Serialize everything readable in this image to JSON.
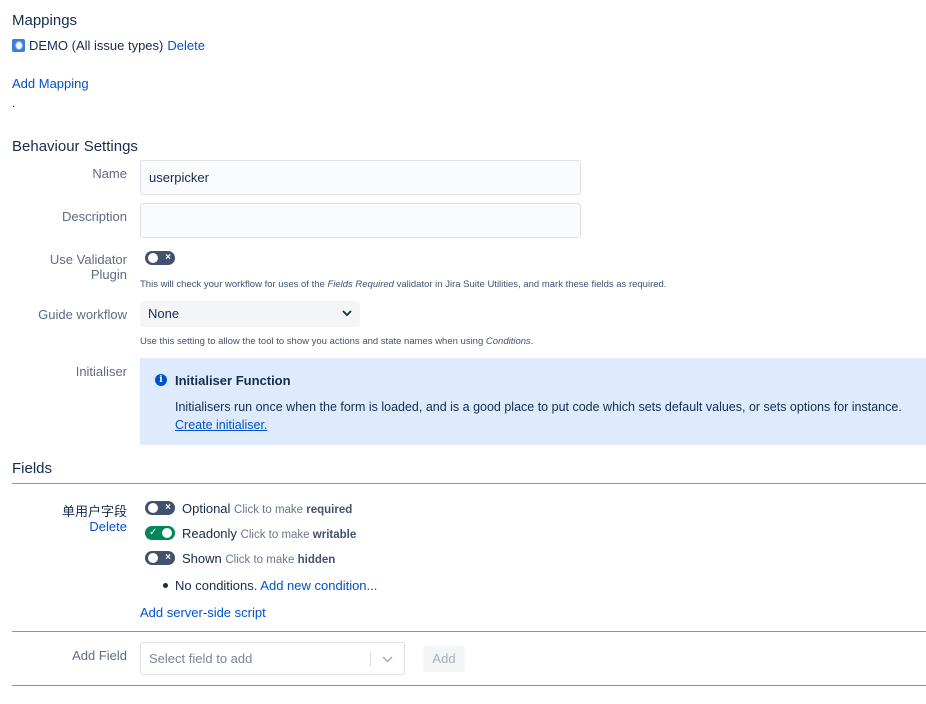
{
  "mappings": {
    "heading": "Mappings",
    "items": [
      {
        "project": "DEMO (All issue types)",
        "delete_label": "Delete"
      }
    ],
    "add_mapping_label": "Add Mapping",
    "dot": "."
  },
  "behaviour": {
    "heading": "Behaviour Settings",
    "name_label": "Name",
    "name_value": "userpicker",
    "description_label": "Description",
    "description_value": "",
    "validator_label": "Use Validator Plugin",
    "validator_enabled": false,
    "validator_help_prefix": "This will check your workflow for uses of the ",
    "validator_help_em": "Fields Required",
    "validator_help_suffix": " validator in Jira Suite Utilities, and mark these fields as required.",
    "guide_label": "Guide workflow",
    "guide_value": "None",
    "guide_help_prefix": "Use this setting to allow the tool to show you actions and state names when using ",
    "guide_help_em": "Conditions",
    "guide_help_suffix": ".",
    "initialiser_label": "Initialiser",
    "initialiser_title": "Initialiser Function",
    "initialiser_body": "Initialisers run once when the form is loaded, and is a good place to put code which sets default values, or sets options for instance.",
    "initialiser_link": "Create initialiser."
  },
  "fields": {
    "heading": "Fields",
    "items": [
      {
        "name": "单用户字段",
        "delete_label": "Delete",
        "flags": [
          {
            "state": "Optional",
            "hint_prefix": "Click to make ",
            "hint_bold": "required",
            "on": false
          },
          {
            "state": "Readonly",
            "hint_prefix": "Click to make ",
            "hint_bold": "writable",
            "on": true
          },
          {
            "state": "Shown",
            "hint_prefix": "Click to make ",
            "hint_bold": "hidden",
            "on": false
          }
        ],
        "conditions_text": "No conditions.",
        "add_condition_label": "Add new condition...",
        "add_script_label": "Add server-side script"
      }
    ],
    "add_field_label": "Add Field",
    "add_field_placeholder": "Select field to add",
    "add_button_label": "Add"
  },
  "colors": {
    "link": "#0052cc",
    "toggle_on": "#00875a",
    "toggle_off": "#42526e",
    "info_panel": "#deebff"
  },
  "icons": {
    "project": "project-avatar-icon",
    "info": "info-icon",
    "chevron": "chevron-down-icon",
    "toggle_off_mark": "×",
    "toggle_on_mark": "✓"
  }
}
